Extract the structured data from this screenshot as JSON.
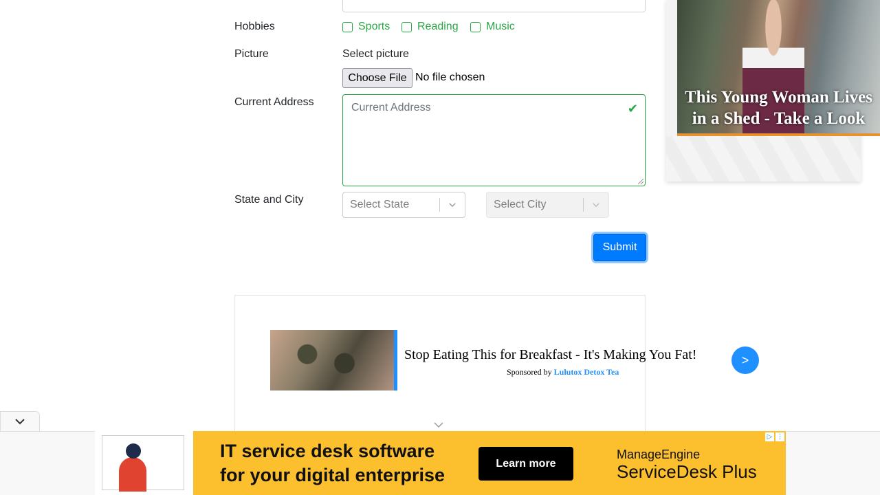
{
  "form": {
    "hobbies": {
      "label": "Hobbies",
      "options": [
        "Sports",
        "Reading",
        "Music"
      ]
    },
    "picture": {
      "label": "Picture",
      "select_text": "Select picture",
      "button_label": "Choose File",
      "status": "No file chosen"
    },
    "address": {
      "label": "Current Address",
      "placeholder": "Current Address"
    },
    "state_city": {
      "label": "State and City",
      "state_placeholder": "Select State",
      "city_placeholder": "Select City"
    },
    "submit_label": "Submit"
  },
  "right_ad": {
    "caption": "This Young Woman Lives in a Shed - Take a Look"
  },
  "sponsored_ad": {
    "title": "Stop Eating This for Breakfast - It's Making You Fat!",
    "sponsored_prefix": "Sponsored by",
    "sponsor": "Lulutox Detox Tea",
    "go_label": ">"
  },
  "bottom_banner": {
    "headline_line1": "IT service desk software",
    "headline_line2": "for your digital enterprise",
    "cta": "Learn more",
    "brand_line1": "ManageEngine",
    "brand_line2": "ServiceDesk Plus"
  },
  "colors": {
    "valid_green": "#28a745",
    "primary_blue": "#007bff",
    "banner_yellow": "#fcbf2e"
  }
}
